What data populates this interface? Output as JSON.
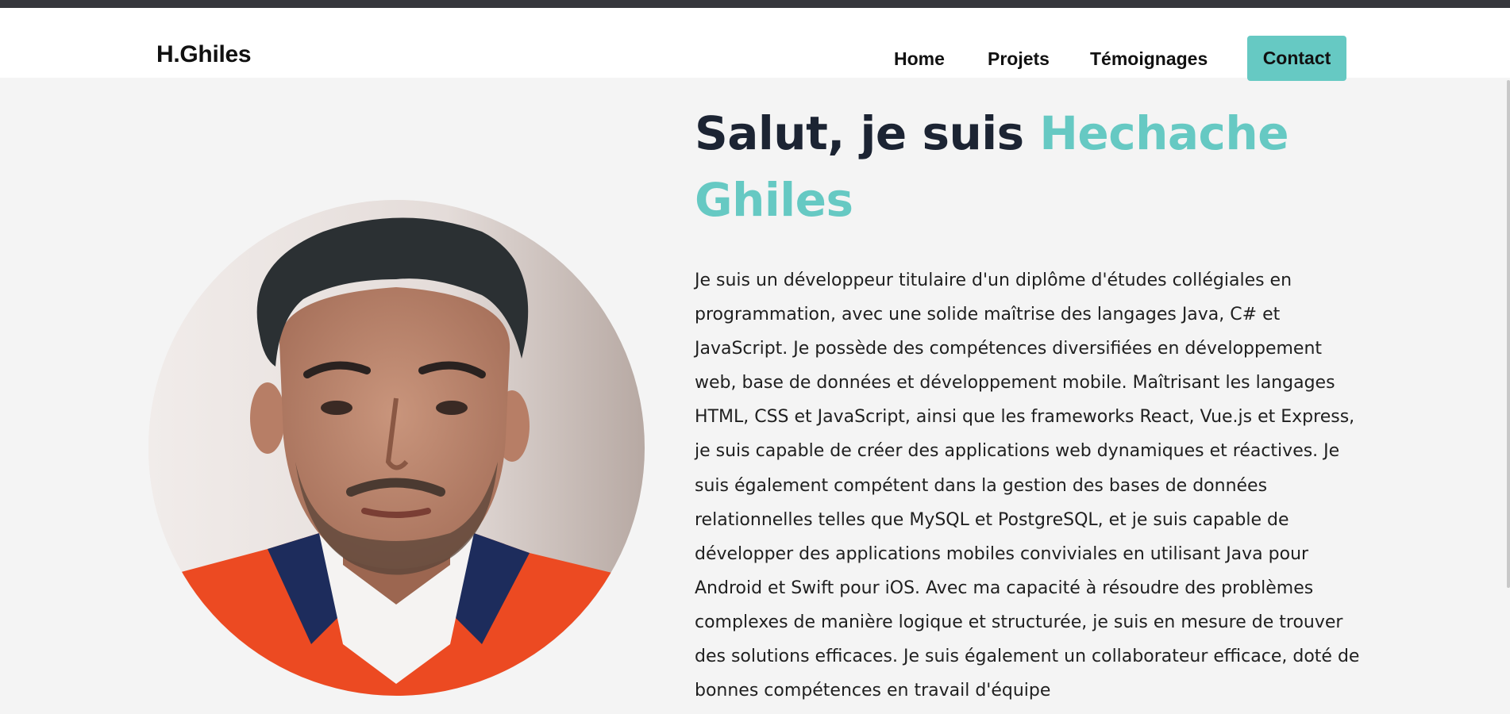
{
  "header": {
    "logo": "H.Ghiles",
    "nav": {
      "home": "Home",
      "projets": "Projets",
      "temoignages": "Témoignages",
      "contact": "Contact"
    }
  },
  "hero": {
    "greeting": "Salut, je suis ",
    "name": "Hechache Ghiles",
    "bio": "Je suis un développeur titulaire d'un diplôme d'études collégiales en programmation, avec une solide maîtrise des langages Java, C# et JavaScript. Je possède des compétences diversifiées en développement web, base de données et développement mobile. Maîtrisant les langages HTML, CSS et JavaScript, ainsi que les frameworks React, Vue.js et Express, je suis capable de créer des applications web dynamiques et réactives. Je suis également compétent dans la gestion des bases de données relationnelles telles que MySQL et PostgreSQL, et je suis capable de développer des applications mobiles conviviales en utilisant Java pour Android et Swift pour iOS. Avec ma capacité à résoudre des problèmes complexes de manière logique et structurée, je suis en mesure de trouver des solutions efficaces. Je suis également un collaborateur efficace, doté de bonnes compétences en travail d'équipe"
  },
  "colors": {
    "accent": "#66c9c3",
    "heading": "#1c2433",
    "background": "#f4f4f4",
    "topbar": "#36373c"
  }
}
